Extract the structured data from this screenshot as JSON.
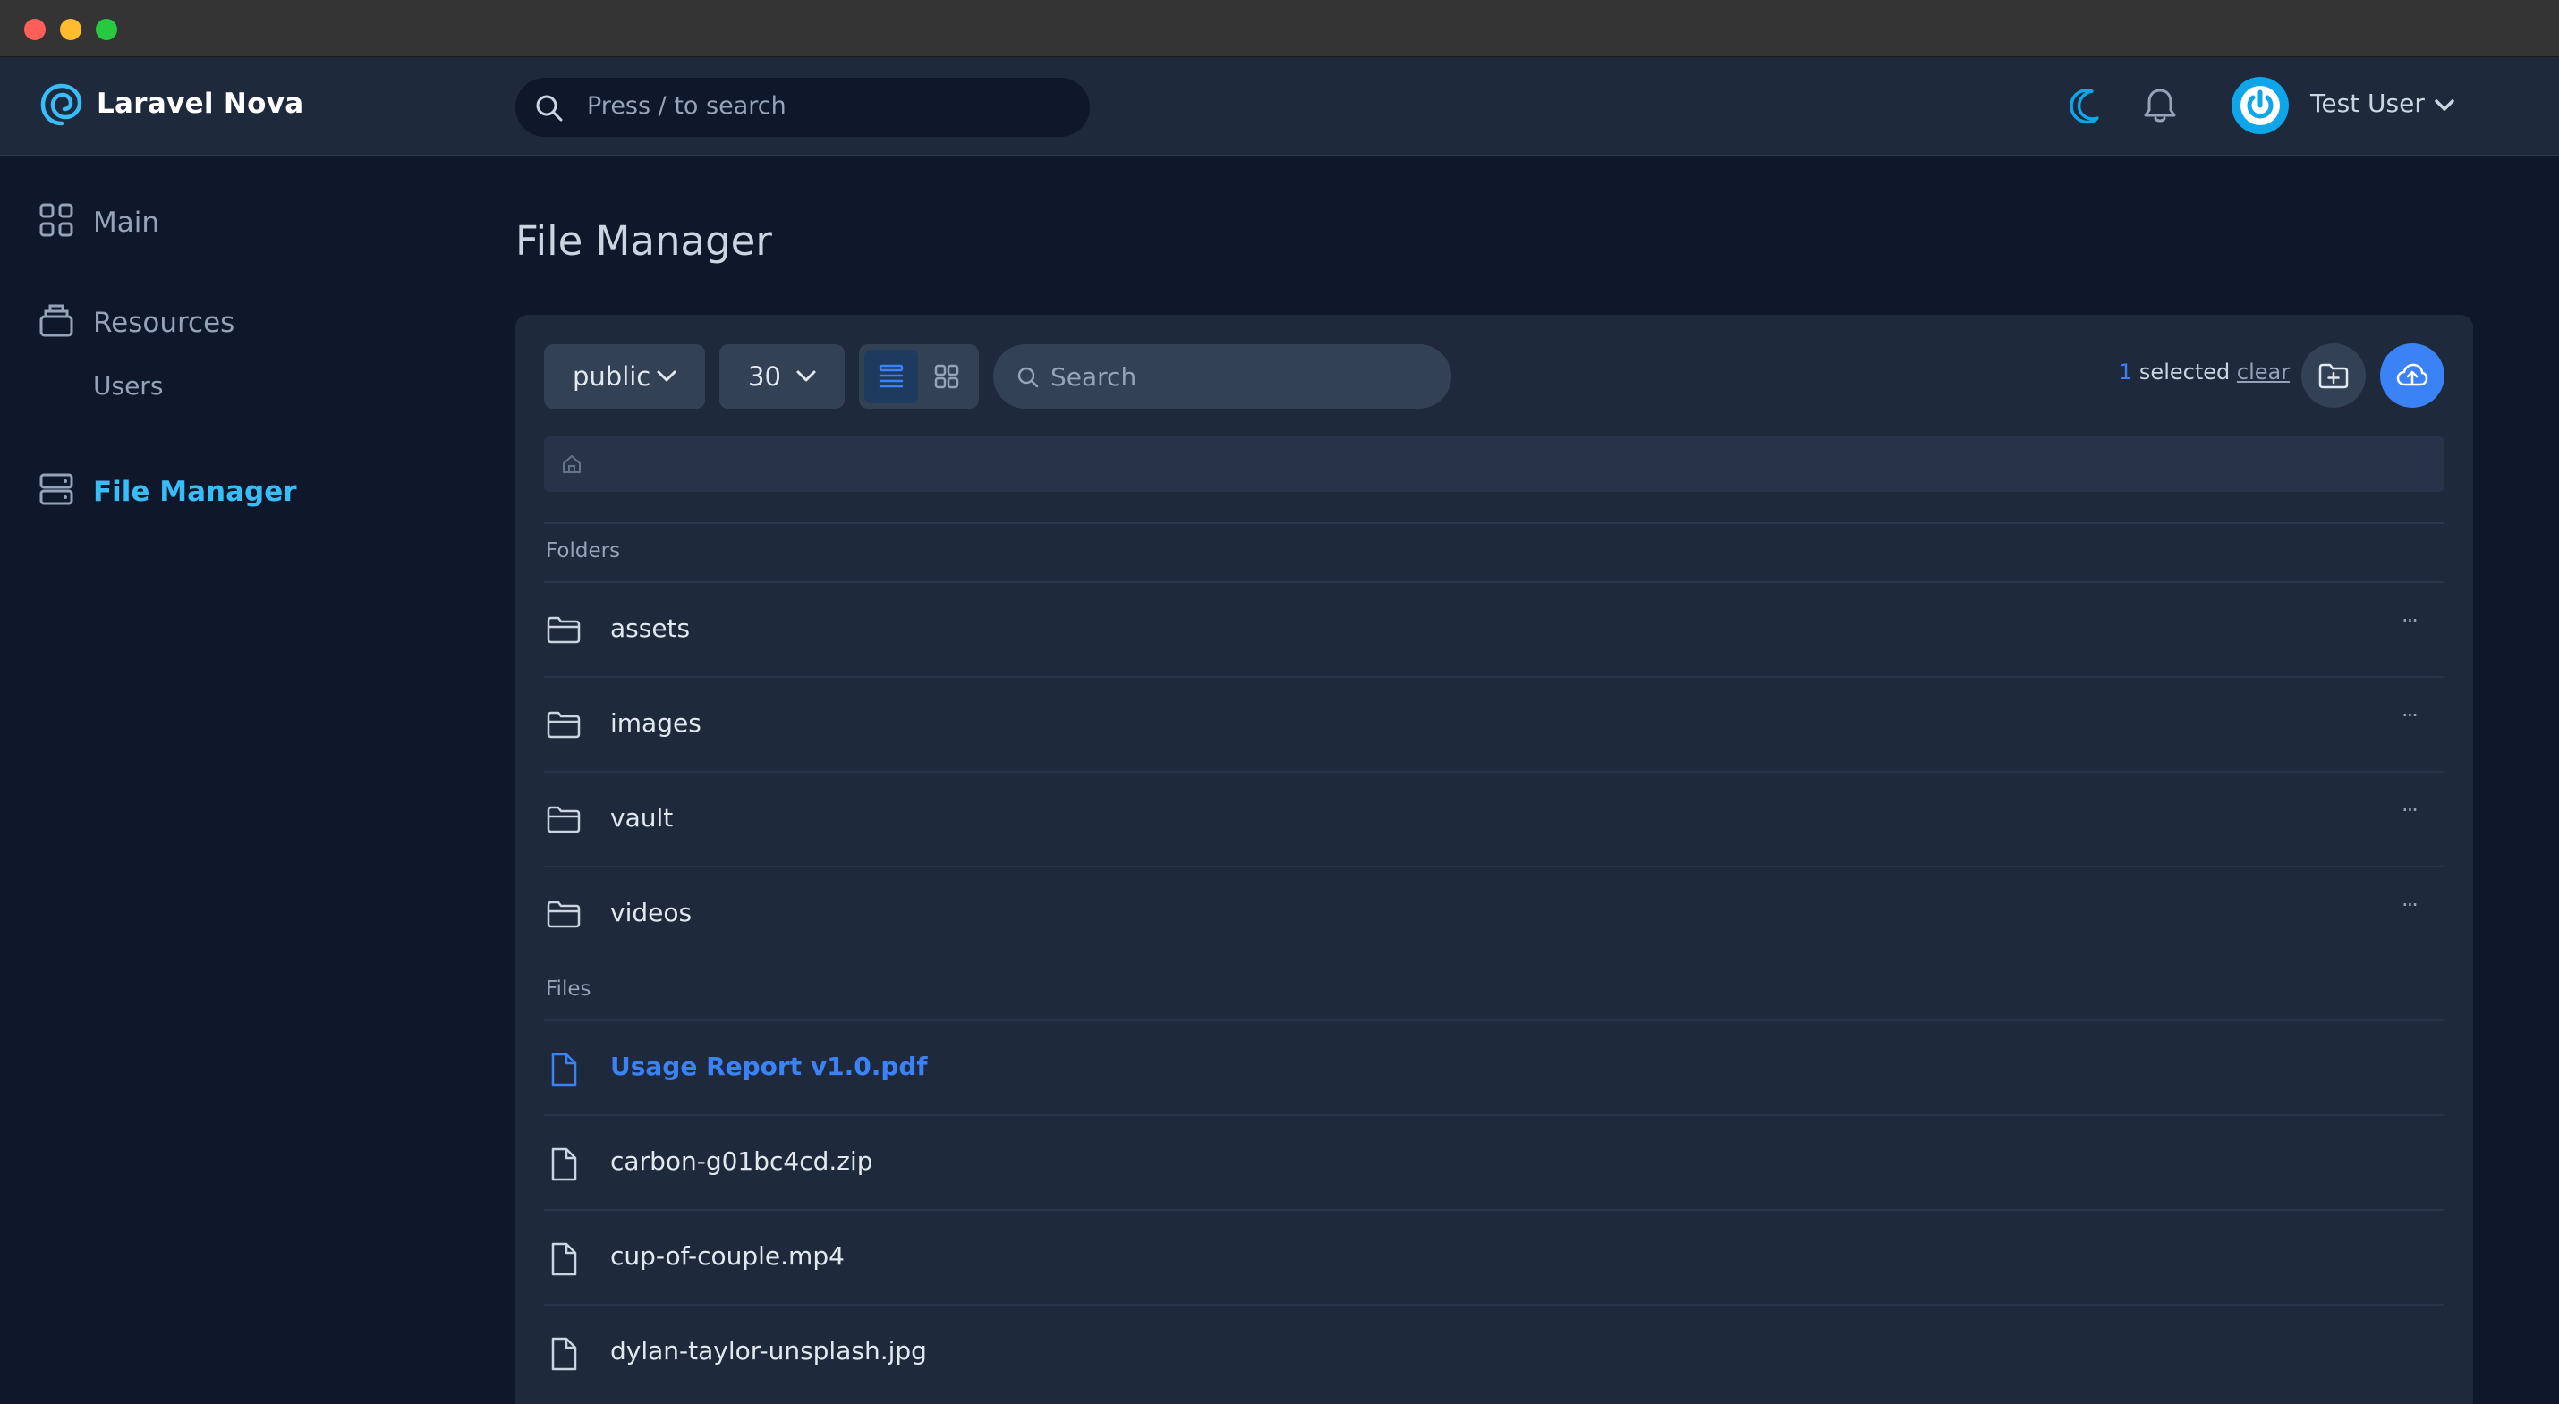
{
  "app": {
    "brand": "Laravel Nova"
  },
  "header": {
    "search_placeholder": "Press / to search",
    "user_name": "Test User"
  },
  "sidebar": {
    "items": [
      {
        "label": "Main",
        "icon": "grid-icon"
      },
      {
        "label": "Resources",
        "icon": "stack-icon"
      },
      {
        "label": "Users"
      },
      {
        "label": "File Manager",
        "icon": "server-icon",
        "active": true
      }
    ]
  },
  "page": {
    "title": "File Manager"
  },
  "toolbar": {
    "disk": "public",
    "per_page": "30",
    "search_placeholder": "Search",
    "selected_count": "1",
    "selected_text": "selected",
    "clear_label": "clear"
  },
  "sections": {
    "folders": "Folders",
    "files": "Files"
  },
  "folders": [
    {
      "name": "assets"
    },
    {
      "name": "images"
    },
    {
      "name": "vault"
    },
    {
      "name": "videos"
    }
  ],
  "files": [
    {
      "name": "Usage Report v1.0.pdf",
      "selected": true
    },
    {
      "name": "carbon-g01bc4cd.zip"
    },
    {
      "name": "cup-of-couple.mp4"
    },
    {
      "name": "dylan-taylor-unsplash.jpg"
    }
  ],
  "colors": {
    "accent": "#3b82f6",
    "brand_accent": "#38bdf8",
    "background": "#0f172a",
    "surface": "#1e293b"
  },
  "more_glyph": "···"
}
